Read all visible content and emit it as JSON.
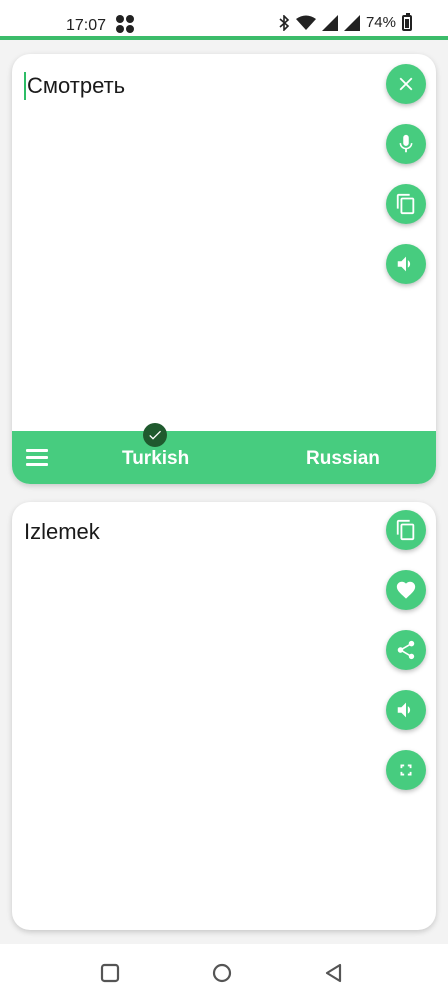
{
  "status_bar": {
    "time": "17:07",
    "battery": "74%"
  },
  "source_panel": {
    "text": "Смотреть",
    "buttons": [
      "close-icon",
      "microphone-icon",
      "copy-icon",
      "volume-icon"
    ]
  },
  "language_bar": {
    "from": "Turkish",
    "to": "Russian"
  },
  "output_panel": {
    "text": "Izlemek",
    "buttons": [
      "copy-icon",
      "heart-icon",
      "share-icon",
      "volume-icon",
      "fullscreen-icon"
    ]
  },
  "colors": {
    "accent": "#47cc7f",
    "status_line": "#3cbc6a",
    "check_badge": "#1f5a2e"
  }
}
